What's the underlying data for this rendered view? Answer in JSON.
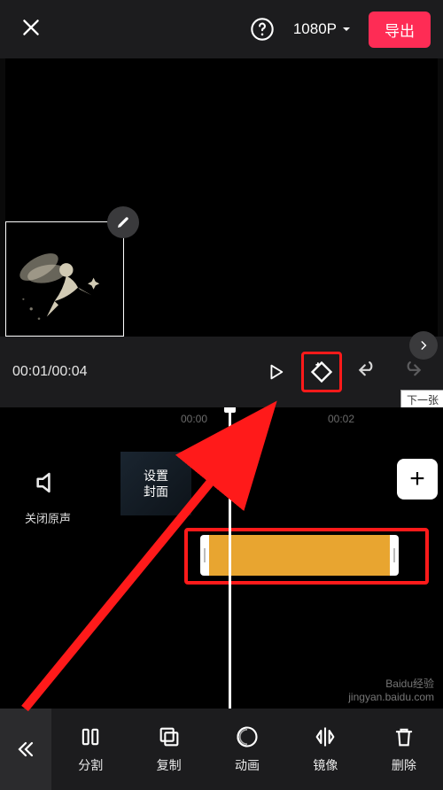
{
  "header": {
    "resolution": "1080P",
    "export_label": "导出"
  },
  "transport": {
    "current_time": "00:01",
    "total_time": "00:04"
  },
  "tooltip": {
    "next": "下一张"
  },
  "timeline": {
    "tick1": "00:00",
    "tick2": "00:02",
    "mute_label": "关闭原声",
    "cover_label_line1": "设置",
    "cover_label_line2": "封面"
  },
  "toolbar": {
    "split": "分割",
    "copy": "复制",
    "animate": "动画",
    "mirror": "镜像",
    "delete": "删除"
  },
  "watermark": {
    "line1": "Baidu经验",
    "line2": "jingyan.baidu.com"
  },
  "colors": {
    "accent": "#fe2c55",
    "highlight": "#ff1a1a",
    "sticker": "#e8a530"
  }
}
